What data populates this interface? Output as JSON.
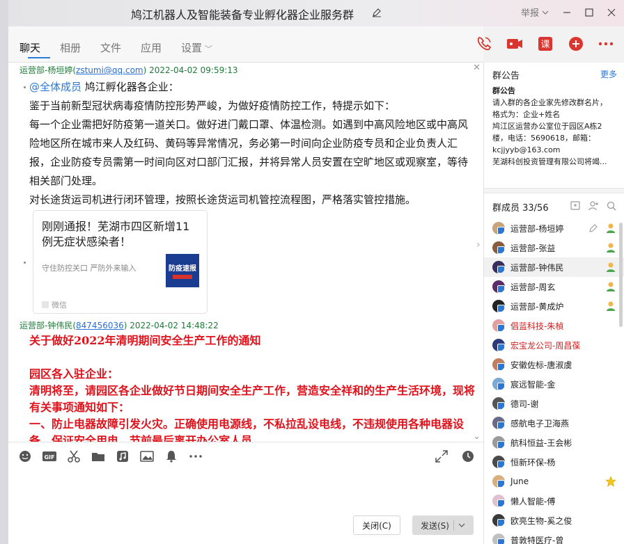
{
  "window": {
    "title": "鸠江机器人及智能装备专业孵化器企业服务群",
    "report_label": "举报"
  },
  "tabs": [
    {
      "label": "聊天"
    },
    {
      "label": "相册"
    },
    {
      "label": "文件"
    },
    {
      "label": "应用"
    },
    {
      "label": "设置"
    }
  ],
  "top_action_course_label": "课",
  "messages": [
    {
      "sender": "运营部-杨垣婷",
      "email": "zstumi@qq.com",
      "time": "2022-04-02 09:59:13",
      "mention": "@全体成员",
      "line1_rest": " 鸠江孵化器各企业：",
      "lines": [
        "鉴于当前新型冠状病毒疫情防控形势严峻，为做好疫情防控工作，特提示如下：",
        "每一个企业需把好防疫第一道关口。做好进门戴口罩、体温检测。如遇到中高风险地区或中高风险地区所在城市来人及红码、黄码等异常情况，务必第一时间向企业防疫专员和企业负责人汇报，企业防疫专员需第一时间向区对口部门汇报，并将异常人员安置在空旷地区或观察室，等待相关部门处理。",
        "对长途货运司机进行闭环管理，按照长途货运司机管控流程图，严格落实管控措施。"
      ],
      "card": {
        "title": "刚刚通报！芜湖市四区新增11例无症状感染者！",
        "subtitle": "守住防控关口  严防外来输入",
        "thumb_label": "防疫速报",
        "source": "微信"
      }
    },
    {
      "sender": "运营部-钟伟民",
      "email": "847456036",
      "time": "2022-04-02 14:48:22",
      "lines": [
        "关于做好2022年清明期间安全生产工作的通知",
        "",
        "园区各入驻企业：",
        "清明将至，请园区各企业做好节日期间安全生产工作，营造安全祥和的生产生活环境，现将有关事项通知如下：",
        "一、防止电器故障引发火灾。正确使用电源线，不私拉乱设电线，不违规使用各种电器设备，保证安全用电。节前最后离开办公室人员"
      ]
    }
  ],
  "composer": {
    "close_label": "关闭(C)",
    "send_label": "发送(S)"
  },
  "announcement": {
    "header": "群公告",
    "more": "更多",
    "title": "群公告",
    "lines": [
      "请入群的各企业家先修改群名片，",
      "格式为：企业+姓名",
      "鸠江区运营办公室位于园区A栋2",
      "楼，电话：5690618，邮箱：",
      "kcjjyyb@163.com",
      "芜湖科创投资管理有限公司将竭..."
    ]
  },
  "members_header": "群成员 33/56",
  "members": [
    {
      "name": "运营部-杨垣婷",
      "color": "#c9a37a",
      "admin": true,
      "editable": true
    },
    {
      "name": "运营部-张益",
      "color": "#8a5b3c",
      "admin": true
    },
    {
      "name": "运营部-钟伟民",
      "color": "#3a2e5e",
      "admin": true,
      "highlight": true
    },
    {
      "name": "运营部-周玄",
      "color": "#5b2a6a",
      "admin": true
    },
    {
      "name": "运营部-黄成炉",
      "color": "#222222",
      "admin": true
    },
    {
      "name": "倡蓝科技-朱楨",
      "color": "#e0a0a0",
      "red": true
    },
    {
      "name": "宏宝龙公司-周昌葆",
      "color": "#2a3a7a",
      "red": true
    },
    {
      "name": "安徽佐标-唐淑虞",
      "color": "#c08060"
    },
    {
      "name": "宸远智能-金",
      "color": "#7aa8d8"
    },
    {
      "name": "德司-谢",
      "color": "#555555"
    },
    {
      "name": "感航电子卫海燕",
      "color": "#6a6a8a"
    },
    {
      "name": "航科恒益-王会彬",
      "color": "#9a9a9a"
    },
    {
      "name": "恒新环保-杨",
      "color": "#4a4a4a"
    },
    {
      "name": "June",
      "color": "#d8b080",
      "star": true
    },
    {
      "name": "懒人智能-傅",
      "color": "#e0c0d0"
    },
    {
      "name": "欧亮生物-奚之俊",
      "color": "#3a3a3a"
    },
    {
      "name": "普敦特医疗-曾",
      "color": "#c0c0c0"
    }
  ]
}
